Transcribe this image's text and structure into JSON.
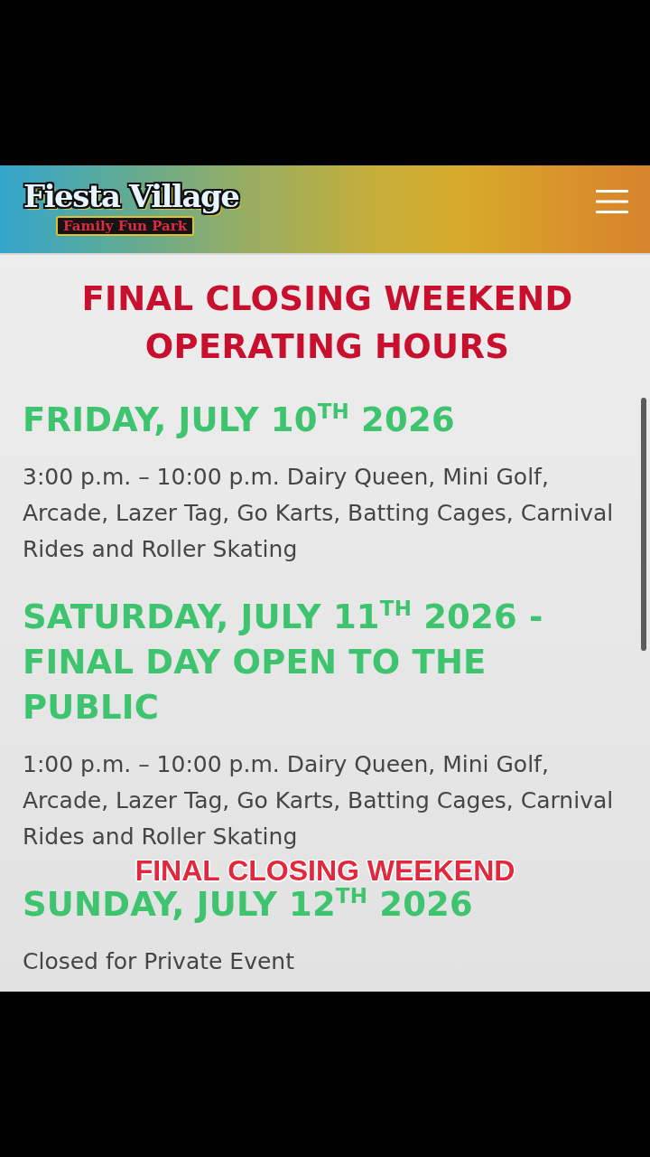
{
  "header": {
    "logo": {
      "name": "Fiesta Village",
      "tagline": "Family Fun Park"
    }
  },
  "page_title": "FINAL CLOSING WEEKEND OPERATING HOURS",
  "days": [
    {
      "heading": "FRIDAY, JULY 10$^{TH}$ 2026",
      "details": "3:00 p.m. – 10:00 p.m. Dairy Queen, Mini Golf, Arcade, Lazer Tag, Go Karts, Batting Cages, Carnival Rides and Roller Skating"
    },
    {
      "heading": "SATURDAY, JULY 11$^{TH}$ 2026 - FINAL DAY OPEN TO THE PUBLIC",
      "details": "1:00 p.m. – 10:00 p.m. Dairy Queen, Mini Golf, Arcade, Lazer Tag, Go Karts, Batting Cages, Carnival Rides and Roller Skating"
    },
    {
      "heading": "SUNDAY, JULY 12$^{TH}$ 2026",
      "details": "Closed for Private Event"
    }
  ],
  "caption": "FINAL CLOSING WEEKEND"
}
